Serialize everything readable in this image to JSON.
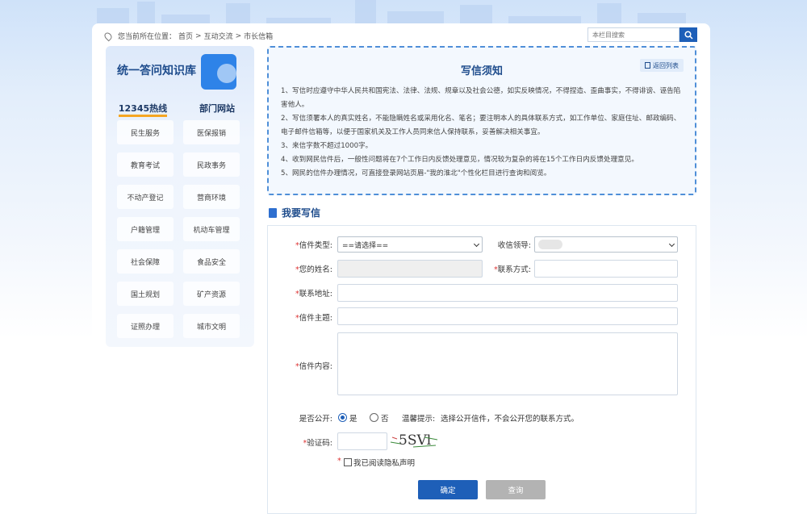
{
  "breadcrumb": {
    "prefix": "您当前所在位置：",
    "items": [
      "首页",
      "互动交流",
      "市长信箱"
    ],
    "sep": ">"
  },
  "search": {
    "placeholder": "本栏目搜索"
  },
  "sidebar": {
    "title": "统一答问知识库",
    "tabs": [
      "12345热线",
      "部门网站"
    ],
    "items": [
      "民生服务",
      "医保报销",
      "教育考试",
      "民政事务",
      "不动产登记",
      "营商环境",
      "户籍管理",
      "机动车管理",
      "社会保障",
      "食品安全",
      "国土规划",
      "矿产资源",
      "证照办理",
      "城市文明"
    ]
  },
  "notice": {
    "title": "写信须知",
    "back_label": "返回列表",
    "lines": [
      "1、写信时应遵守中华人民共和国宪法、法律、法规、规章以及社会公德，如实反映情况，不得捏造、歪曲事实，不得诽谤、诬告陷害他人。",
      "2、写信须署本人的真实姓名，不能隐瞒姓名或采用化名、笔名；要注明本人的具体联系方式，如工作单位、家庭住址、邮政编码、电子邮件信箱等，以便于国家机关及工作人员同来信人保持联系，妥善解决相关事宜。",
      "3、来信字数不超过1000字。",
      "4、收到网民信件后，一般性问题将在7个工作日内反馈处理意见，情况较为复杂的将在15个工作日内反馈处理意见。",
      "5、网民的信件办理情况，可直接登录网站页眉-\"我的淮北\"个性化栏目进行查询和阅览。"
    ]
  },
  "form": {
    "section_title": "我要写信",
    "required_mark": "*",
    "letter_type_label": "信件类型:",
    "letter_type_value": "==请选择==",
    "recipient_label": "收信领导:",
    "name_label": "您的姓名:",
    "contact_label": "联系方式:",
    "address_label": "联系地址:",
    "subject_label": "信件主题:",
    "content_label": "信件内容:",
    "public_label": "是否公开:",
    "public_yes": "是",
    "public_no": "否",
    "tip_label": "温馨提示:",
    "tip_text": "选择公开信件，不会公开您的联系方式。",
    "captcha_label": "验证码:",
    "captcha_text": "5SVl",
    "privacy_label": "我已阅读隐私声明",
    "submit_label": "确定",
    "query_label": "查询"
  },
  "colors": {
    "primary": "#1e5fb8",
    "notice_border": "#4f8fd8",
    "required": "#d33333"
  }
}
